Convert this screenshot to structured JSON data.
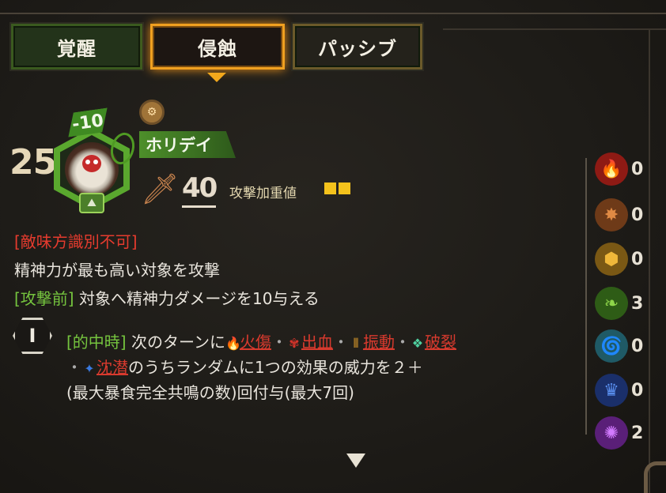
{
  "tabs": [
    {
      "label": "覚醒",
      "active": false
    },
    {
      "label": "侵蝕",
      "active": true
    },
    {
      "label": "パッシブ",
      "active": false
    }
  ],
  "character": {
    "level": "25",
    "cost_modifier": "-10",
    "name": "ホリデイ",
    "attack_value": "40",
    "attack_weight_label": "攻撃加重値"
  },
  "description": {
    "line1": "[敵味方識別不可]",
    "line2": "精神力が最も高い対象を攻撃",
    "line3_tag": "[攻撃前]",
    "line3_text": " 対象へ精神力ダメージを10与える"
  },
  "effect": {
    "number": "I",
    "tag": "[的中時]",
    "text1": " 次のターンに",
    "burn": "火傷",
    "sep": "・",
    "bleed": "出血",
    "tremor": "振動",
    "rupture": "破裂",
    "sinking": "沈潜",
    "text2": "のうちランダムに1つの効果の威力を２＋",
    "text3": "(最大暴食完全共鳴の数)回付与(最大7回)"
  },
  "resources": [
    {
      "name": "wrath",
      "count": "0",
      "color": "#d42a1e"
    },
    {
      "name": "lust",
      "count": "0",
      "color": "#c9762e"
    },
    {
      "name": "sloth",
      "count": "0",
      "color": "#e0a12a"
    },
    {
      "name": "gluttony",
      "count": "3",
      "color": "#6dbb2f"
    },
    {
      "name": "gloom",
      "count": "0",
      "color": "#5fb6c6"
    },
    {
      "name": "pride",
      "count": "0",
      "color": "#3c6fcf"
    },
    {
      "name": "envy",
      "count": "2",
      "color": "#9a3fc0"
    }
  ],
  "colors": {
    "accent_orange": "#f0a020",
    "tag_red": "#e53b2e",
    "tag_green": "#75c43e",
    "weight_yellow": "#f4c21c"
  }
}
